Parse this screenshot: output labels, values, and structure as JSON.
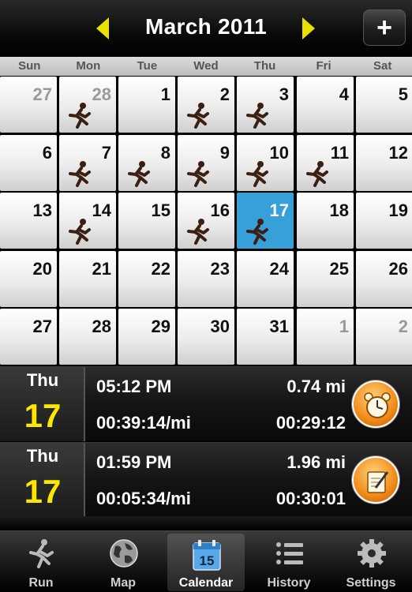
{
  "header": {
    "title": "March 2011",
    "add_label": "+"
  },
  "weekdays": [
    "Sun",
    "Mon",
    "Tue",
    "Wed",
    "Thu",
    "Fri",
    "Sat"
  ],
  "calendar": {
    "weeks": [
      [
        {
          "day": "27",
          "other": true,
          "run": false
        },
        {
          "day": "28",
          "other": true,
          "run": true
        },
        {
          "day": "1",
          "run": false
        },
        {
          "day": "2",
          "run": true
        },
        {
          "day": "3",
          "run": true
        },
        {
          "day": "4",
          "run": false
        },
        {
          "day": "5",
          "run": false
        }
      ],
      [
        {
          "day": "6",
          "run": false
        },
        {
          "day": "7",
          "run": true
        },
        {
          "day": "8",
          "run": true
        },
        {
          "day": "9",
          "run": true
        },
        {
          "day": "10",
          "run": true
        },
        {
          "day": "11",
          "run": true
        },
        {
          "day": "12",
          "run": false
        }
      ],
      [
        {
          "day": "13",
          "run": false
        },
        {
          "day": "14",
          "run": true
        },
        {
          "day": "15",
          "run": false
        },
        {
          "day": "16",
          "run": true
        },
        {
          "day": "17",
          "run": true,
          "today": true
        },
        {
          "day": "18",
          "run": false
        },
        {
          "day": "19",
          "run": false
        }
      ],
      [
        {
          "day": "20",
          "run": false
        },
        {
          "day": "21",
          "run": false
        },
        {
          "day": "22",
          "run": false
        },
        {
          "day": "23",
          "run": false
        },
        {
          "day": "24",
          "run": false
        },
        {
          "day": "25",
          "run": false
        },
        {
          "day": "26",
          "run": false
        }
      ],
      [
        {
          "day": "27",
          "run": false
        },
        {
          "day": "28",
          "run": false
        },
        {
          "day": "29",
          "run": false
        },
        {
          "day": "30",
          "run": false
        },
        {
          "day": "31",
          "run": false
        },
        {
          "day": "1",
          "other": true,
          "run": false
        },
        {
          "day": "2",
          "other": true,
          "run": false
        }
      ]
    ]
  },
  "entries": [
    {
      "dow": "Thu",
      "day": "17",
      "time": "05:12 PM",
      "distance": "0.74 mi",
      "pace": "00:39:14/mi",
      "duration": "00:29:12",
      "icon": "stopwatch-icon"
    },
    {
      "dow": "Thu",
      "day": "17",
      "time": "01:59 PM",
      "distance": "1.96 mi",
      "pace": "00:05:34/mi",
      "duration": "00:30:01",
      "icon": "notepad-icon"
    }
  ],
  "tabs": [
    {
      "label": "Run",
      "icon": "runner-icon"
    },
    {
      "label": "Map",
      "icon": "globe-icon"
    },
    {
      "label": "Calendar",
      "icon": "calendar-icon",
      "badge": "15",
      "active": true
    },
    {
      "label": "History",
      "icon": "list-icon"
    },
    {
      "label": "Settings",
      "icon": "gear-icon"
    }
  ],
  "colors": {
    "accent_yellow": "#ffe600",
    "today_blue": "#38a0d8",
    "icon_orange": "#f08a1a"
  }
}
